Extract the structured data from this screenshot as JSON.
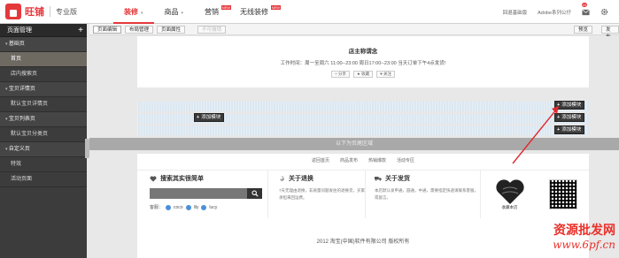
{
  "app": {
    "brand": "旺铺",
    "edition": "专业版"
  },
  "nav": [
    {
      "label": "装修",
      "active": true,
      "caret": "▾"
    },
    {
      "label": "商品",
      "active": false,
      "caret": "▾"
    },
    {
      "label": "营销",
      "active": false,
      "badge": "NEW"
    },
    {
      "label": "无线装修",
      "active": false,
      "badge": "NEW"
    }
  ],
  "top_right": {
    "back_link": "回退基础版",
    "adobe_link": "Adobe系列公仔",
    "mail_icon": "mail-icon",
    "mail_count": "24",
    "settings_icon": "gear-icon"
  },
  "sidebar": {
    "title": "页面管理",
    "add_icon": "+",
    "items": [
      {
        "label": "基础页",
        "type": "group"
      },
      {
        "label": "首页",
        "type": "item",
        "active": true
      },
      {
        "label": "店内搜索页",
        "type": "item"
      },
      {
        "label": "宝贝详情页",
        "type": "group"
      },
      {
        "label": "默认宝贝详情页",
        "type": "item"
      },
      {
        "label": "宝贝列表页",
        "type": "group"
      },
      {
        "label": "默认宝贝分类页",
        "type": "item"
      },
      {
        "label": "自定义页",
        "type": "group"
      },
      {
        "label": "特效",
        "type": "item"
      },
      {
        "label": "活动页面",
        "type": "item"
      }
    ]
  },
  "toolbar": {
    "tabs": [
      {
        "label": "页面编辑",
        "state": "active"
      },
      {
        "label": "布局管理",
        "state": "normal"
      },
      {
        "label": "页面属性",
        "state": "normal"
      },
      {
        "label": "不可撤销",
        "state": "disabled"
      }
    ],
    "preview": "预览",
    "publish": "发布"
  },
  "store": {
    "title": "店主称谓念",
    "hours": "工作时间：周一至周六 11:00--23:00 周日17:00--23:00 当天订单下午4点发货!",
    "buttons": [
      "+ 分享",
      "★ 收藏",
      "♥ 关注"
    ]
  },
  "add_module_label": "添加模块",
  "divider_label": "以下为页尾区域",
  "footer": {
    "links": [
      "返回首页",
      "商品发布",
      "热销爆款",
      "活动专区"
    ],
    "search_title": "搜索其实很简单",
    "service_label": "客服：",
    "service_names": [
      "coco",
      "lily",
      "lucy"
    ],
    "return_title": "关于退换",
    "return_text": "7天无理由退换，非质量问题发往的退换货，买家承担来回运费。",
    "ship_title": "关于发货",
    "ship_text": "本店默认发申通，圆通，中通，需要指定快递请联系客服，或留言。",
    "store_badge": "收藏本店",
    "copyright": "2012 淘宝(中国)软件有限公司 版权所有"
  },
  "watermark": {
    "line1": "资源批发网",
    "line2": "www.6pf.cn"
  },
  "colors": {
    "accent": "#e4393c",
    "sidebar_bg": "#3c3c3c",
    "module_stripe": "#dbe7f1",
    "arrow": "#e0292e"
  }
}
